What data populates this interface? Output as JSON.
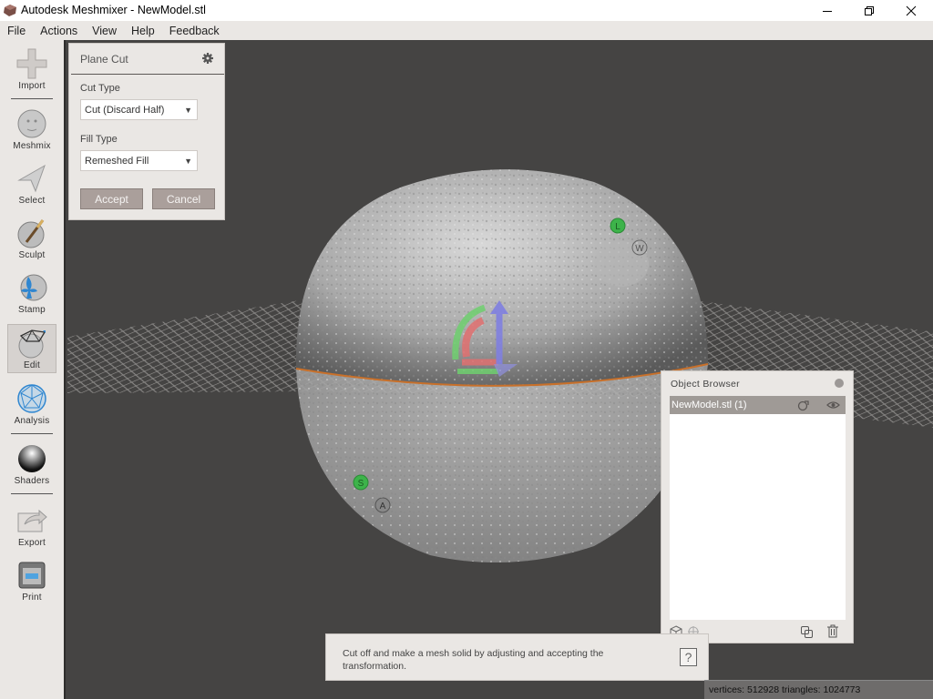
{
  "window": {
    "title": "Autodesk Meshmixer - NewModel.stl",
    "controls": {
      "minimize": "—",
      "maximize": "❐",
      "close": "✕"
    }
  },
  "menu": [
    "File",
    "Actions",
    "View",
    "Help",
    "Feedback"
  ],
  "sidebar": {
    "tools": [
      {
        "label": "Import",
        "icon": "plus-icon"
      },
      {
        "label": "Meshmix",
        "icon": "face-sphere-icon"
      },
      {
        "label": "Select",
        "icon": "arrow-pointer-icon"
      },
      {
        "label": "Sculpt",
        "icon": "brush-sphere-icon"
      },
      {
        "label": "Stamp",
        "icon": "fleur-de-lis-icon"
      },
      {
        "label": "Edit",
        "icon": "edit-mesh-icon",
        "active": true
      },
      {
        "label": "Analysis",
        "icon": "geodesic-sphere-icon"
      },
      {
        "label": "Shaders",
        "icon": "chrome-sphere-icon"
      },
      {
        "label": "Export",
        "icon": "export-arrow-icon"
      },
      {
        "label": "Print",
        "icon": "printer-icon"
      }
    ]
  },
  "plane_cut": {
    "title": "Plane Cut",
    "cut_type_label": "Cut Type",
    "cut_type_value": "Cut (Discard Half)",
    "fill_type_label": "Fill Type",
    "fill_type_value": "Remeshed Fill",
    "accept_label": "Accept",
    "cancel_label": "Cancel"
  },
  "viewport": {
    "markers": [
      {
        "letter": "L",
        "color": "#3db34a"
      },
      {
        "letter": "W",
        "color": "#777777"
      },
      {
        "letter": "S",
        "color": "#3db34a"
      },
      {
        "letter": "A",
        "color": "#777777"
      }
    ],
    "cut_line_color": "#c8702a"
  },
  "object_browser": {
    "title": "Object Browser",
    "items": [
      {
        "label": "NewModel.stl (1)"
      }
    ]
  },
  "help": {
    "text": "Cut off and make a mesh solid by adjusting and accepting the transformation.",
    "button": "?"
  },
  "status": {
    "text": "vertices: 512928 triangles: 1024773"
  }
}
